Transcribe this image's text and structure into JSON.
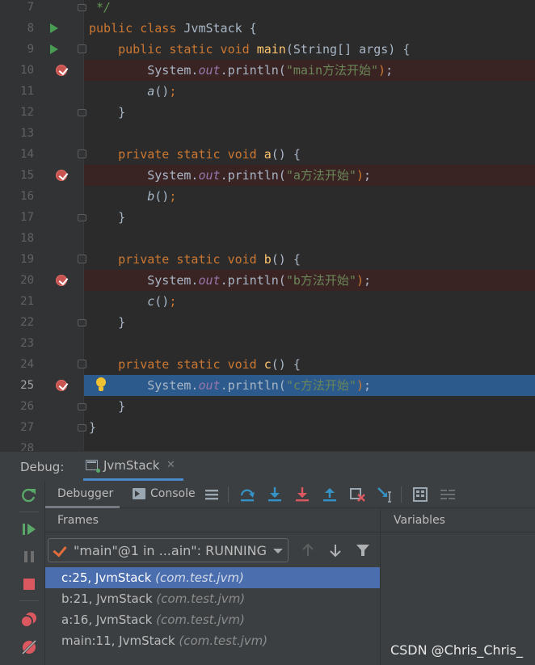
{
  "editor": {
    "lines": [
      {
        "num": "7",
        "code": " */"
      },
      {
        "num": "8",
        "code": "public class JvmStack {"
      },
      {
        "num": "9",
        "code": "    public static void main(String[] args) {"
      },
      {
        "num": "10",
        "code": "        System.out.println(\"main方法开始\");"
      },
      {
        "num": "11",
        "code": "        a();"
      },
      {
        "num": "12",
        "code": "    }"
      },
      {
        "num": "13",
        "code": ""
      },
      {
        "num": "14",
        "code": "    private static void a() {"
      },
      {
        "num": "15",
        "code": "        System.out.println(\"a方法开始\");"
      },
      {
        "num": "16",
        "code": "        b();"
      },
      {
        "num": "17",
        "code": "    }"
      },
      {
        "num": "18",
        "code": ""
      },
      {
        "num": "19",
        "code": "    private static void b() {"
      },
      {
        "num": "20",
        "code": "        System.out.println(\"b方法开始\");"
      },
      {
        "num": "21",
        "code": "        c();"
      },
      {
        "num": "22",
        "code": "    }"
      },
      {
        "num": "23",
        "code": ""
      },
      {
        "num": "24",
        "code": "    private static void c() {"
      },
      {
        "num": "25",
        "code": "        System.out.println(\"c方法开始\");"
      },
      {
        "num": "26",
        "code": "    }"
      },
      {
        "num": "27",
        "code": "}"
      },
      {
        "num": "28",
        "code": ""
      }
    ],
    "breakpoint_lines": [
      "10",
      "15",
      "20",
      "25"
    ],
    "current_line": "25"
  },
  "debug": {
    "label": "Debug:",
    "session_tab": "JvmStack",
    "tabs": {
      "debugger": "Debugger",
      "console": "Console"
    },
    "frames_title": "Frames",
    "variables_title": "Variables",
    "thread_selector": "\"main\"@1 in ...ain\": RUNNING",
    "frames": [
      {
        "location": "c:25, JvmStack",
        "package": "(com.test.jvm)",
        "selected": true
      },
      {
        "location": "b:21, JvmStack",
        "package": "(com.test.jvm)",
        "selected": false
      },
      {
        "location": "a:16, JvmStack",
        "package": "(com.test.jvm)",
        "selected": false
      },
      {
        "location": "main:11, JvmStack",
        "package": "(com.test.jvm)",
        "selected": false
      }
    ],
    "left_toolbar_icons": [
      "rerun-icon",
      "resume-icon",
      "pause-icon",
      "stop-icon",
      "view-breakpoints-icon",
      "mute-breakpoints-icon"
    ],
    "toolbar_icons": [
      "layout-menu-icon",
      "step-over-icon",
      "step-into-icon",
      "force-step-into-icon",
      "step-out-icon",
      "drop-frame-icon",
      "run-to-cursor-icon",
      "evaluate-expression-icon",
      "trace-icon"
    ]
  },
  "watermark": "CSDN @Chris_Chris_",
  "colors": {
    "editor_bg": "#2b2b2b",
    "keyword": "#cc7832",
    "method_decl": "#ffc66d",
    "static_field": "#9876aa",
    "string": "#6a8759",
    "breakpoint": "#c75450",
    "current_line": "#2d5a8c",
    "selected_frame": "#4b6eaf",
    "toolbar_blue": "#3592c4",
    "run_green": "#499c54"
  }
}
